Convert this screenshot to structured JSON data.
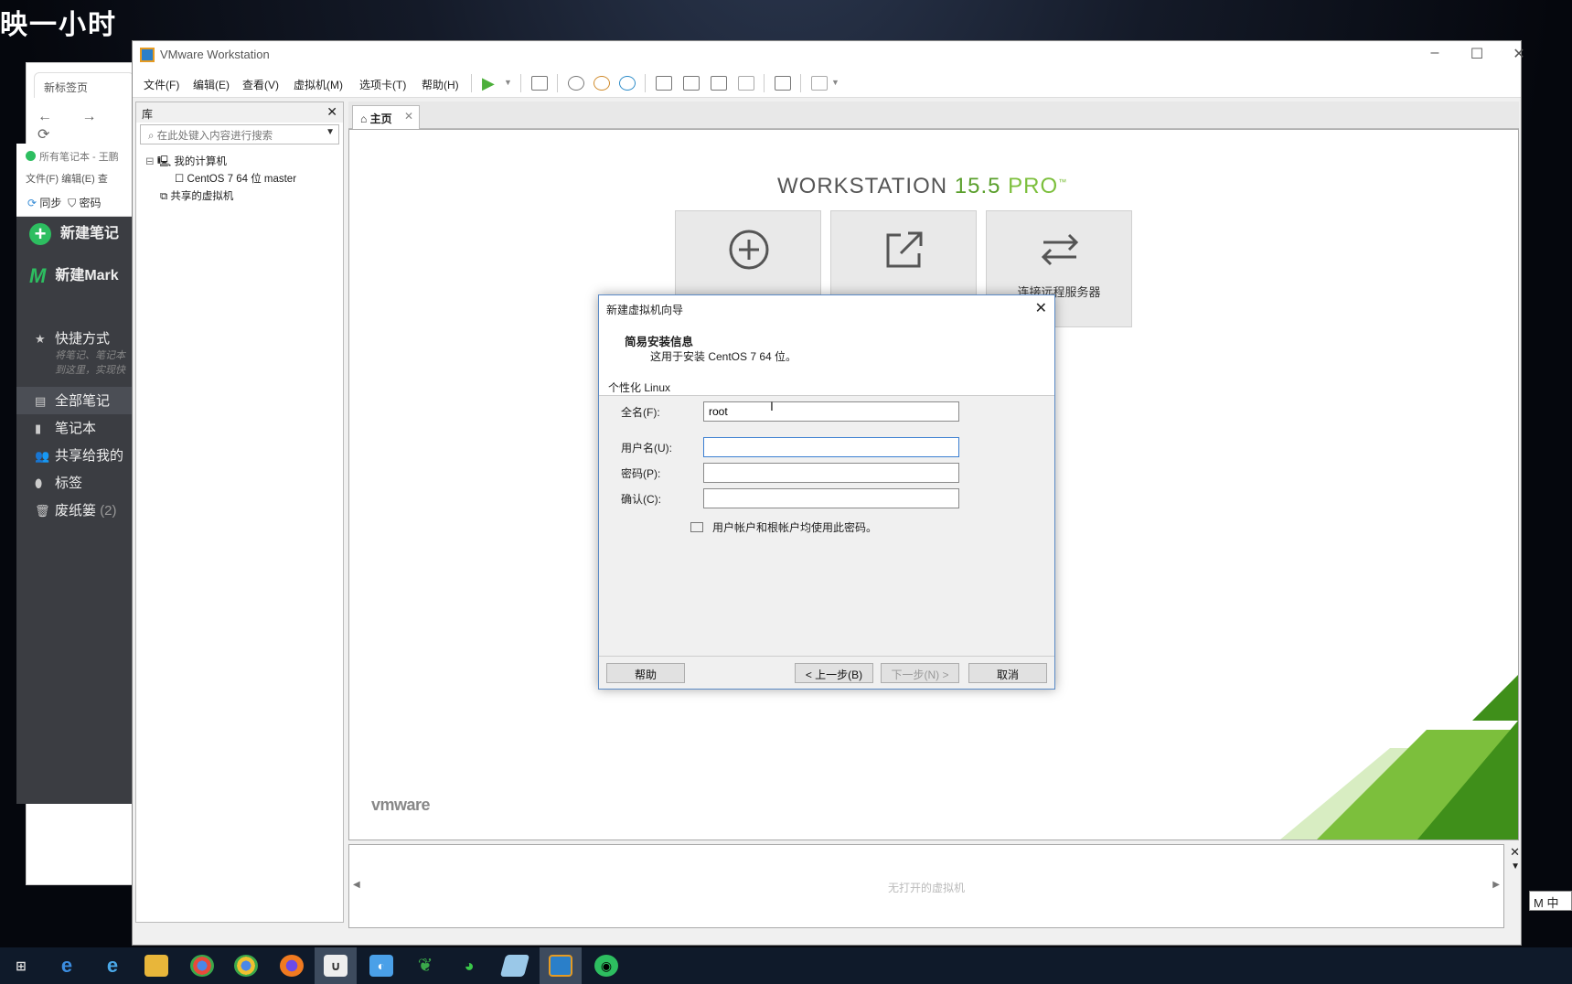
{
  "overlay": {
    "title": "映一小时"
  },
  "browser": {
    "tab_label": "新标签页",
    "nav": "← → ⟳"
  },
  "notes": {
    "title": "所有笔记本 - 王鹏",
    "menu": "文件(F)   编辑(E)   查",
    "sync_label": "同步",
    "password_label": "密码",
    "new_note": "新建笔记",
    "new_markdown": "新建Mark",
    "shortcuts": "快捷方式",
    "shortcut_hint_1": "将笔记、笔记本",
    "shortcut_hint_2": "到这里，实现快",
    "all_notes": "全部笔记",
    "notebooks": "笔记本",
    "shared": "共享给我的",
    "tags": "标签",
    "trash": "废纸篓",
    "trash_count": "(2)"
  },
  "vmware": {
    "window_title": "VMware Workstation",
    "menu": {
      "file": "文件(F)",
      "edit": "编辑(E)",
      "view": "查看(V)",
      "vm": "虚拟机(M)",
      "tabs": "选项卡(T)",
      "help": "帮助(H)"
    },
    "library": {
      "header": "库",
      "search_placeholder": "在此处键入内容进行搜索",
      "my_computer": "我的计算机",
      "vm_name": "CentOS 7 64 位 master",
      "shared_vms": "共享的虚拟机"
    },
    "tab_home": "主页",
    "brand": {
      "name": "WORKSTATION",
      "version": "15.5",
      "edition": "PRO",
      "tm": "™"
    },
    "tiles": {
      "create": "",
      "open": "",
      "connect": "连接远程服务器"
    },
    "vmware_logo": "vmware",
    "thumbs_empty": "无打开的虚拟机"
  },
  "dialog": {
    "title": "新建虚拟机向导",
    "heading": "简易安装信息",
    "subheading": "这用于安装 CentOS 7 64 位。",
    "section": "个性化 Linux",
    "fullname_label": "全名(F):",
    "fullname_value": "root",
    "username_label": "用户名(U):",
    "username_value": "",
    "password_label": "密码(P):",
    "password_value": "",
    "confirm_label": "确认(C):",
    "confirm_value": "",
    "note": "用户帐户和根帐户均使用此密码。",
    "buttons": {
      "help": "帮助",
      "back": "< 上一步(B)",
      "next": "下一步(N) >",
      "cancel": "取消"
    }
  },
  "ime": {
    "label": "M 中"
  },
  "colors": {
    "vmware_green": "#7cbf3c",
    "notes_green": "#2dbe60",
    "dialog_border": "#5a8ac6"
  }
}
